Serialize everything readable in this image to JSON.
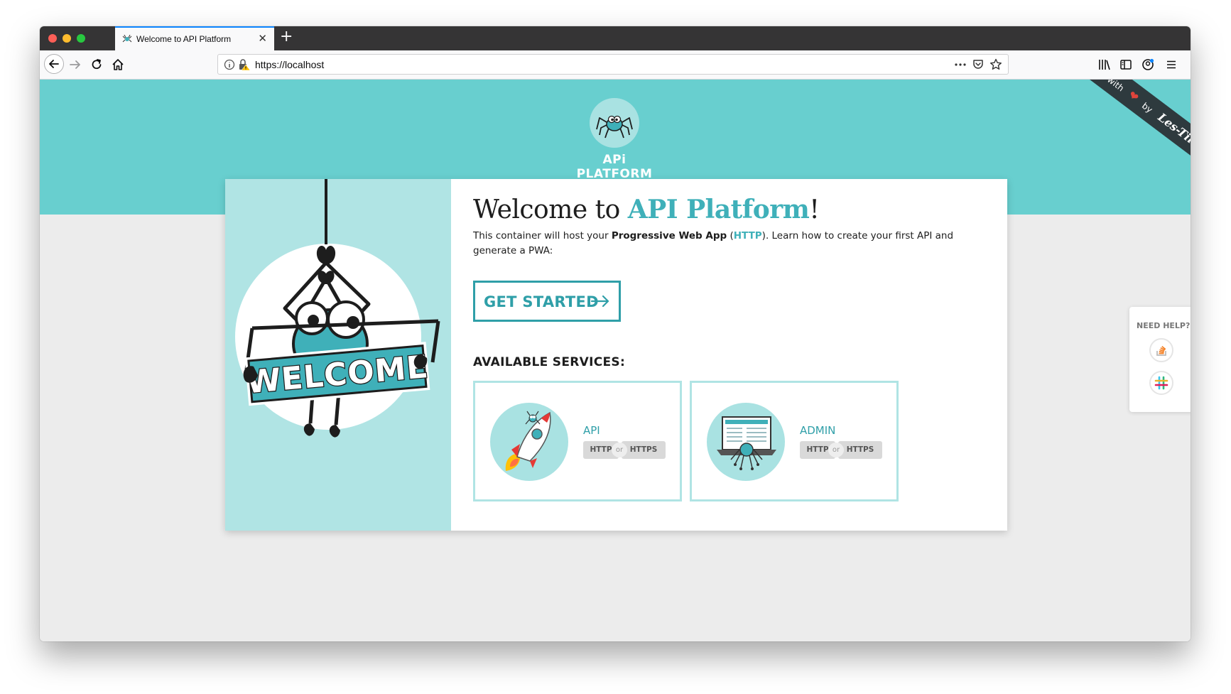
{
  "browser": {
    "tab": {
      "title": "Welcome to API Platform",
      "close_glyph": "✕",
      "favicon": "spider-icon"
    },
    "new_tab_glyph": "+",
    "url": "https://localhost",
    "toolbar_icons": [
      "back-icon",
      "forward-icon",
      "reload-icon",
      "home-icon",
      "info-icon",
      "insecure-lock-icon",
      "more-actions-icon",
      "pocket-icon",
      "bookmark-star-icon",
      "library-icon",
      "sidebar-icon",
      "account-icon",
      "menu-icon"
    ]
  },
  "header": {
    "brand": "APi PLATFORM",
    "ribbon": {
      "made_with": "made with",
      "heart": "❤",
      "by": "by",
      "company": "Les-Tilleuls.coop"
    }
  },
  "welcome": {
    "title_prefix": "Welcome to ",
    "title_accent": "API Platform",
    "title_suffix": "!",
    "intro_part1": "This container will host your ",
    "intro_bold": "Progressive Web App",
    "intro_open": " (",
    "intro_link": "HTTP",
    "intro_part2": "). Learn how to create your first API and generate a PWA:",
    "illustration_text": "WELCOME",
    "get_started": "GET STARTED"
  },
  "services": {
    "title": "AVAILABLE SERVICES:",
    "items": [
      {
        "name": "API",
        "http": "HTTP",
        "or": "or",
        "https": "HTTPS",
        "icon": "rocket-icon"
      },
      {
        "name": "ADMIN",
        "http": "HTTP",
        "or": "or",
        "https": "HTTPS",
        "icon": "laptop-spider-icon"
      }
    ]
  },
  "help": {
    "title": "NEED HELP?",
    "links": [
      "stackoverflow-icon",
      "slack-icon"
    ]
  },
  "colors": {
    "accent": "#3fb0b9",
    "hero": "#68cfcf",
    "panel": "#b0e4e4",
    "ribbon": "#2e3a3e"
  }
}
